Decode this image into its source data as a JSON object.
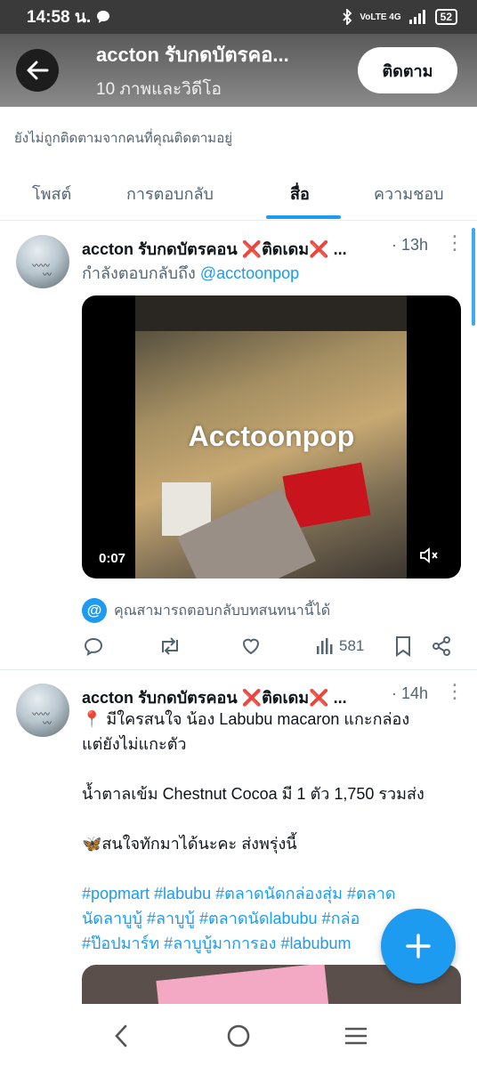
{
  "status_bar": {
    "time": "14:58 น.",
    "network": "VoLTE 4G",
    "battery": "52"
  },
  "header": {
    "title": "accton รับกดบัตรคอ...",
    "subtitle": "10 ภาพและวิดีโอ",
    "follow_label": "ติดตาม"
  },
  "notice": "ยังไม่ถูกติดตามจากคนที่คุณติดตามอยู่",
  "tabs": [
    {
      "label": "โพสต์",
      "active": false
    },
    {
      "label": "การตอบกลับ",
      "active": false
    },
    {
      "label": "สื่อ",
      "active": true
    },
    {
      "label": "ความชอบ",
      "active": false
    }
  ],
  "posts": [
    {
      "author": "accton รับกดบัตรคอน",
      "author_suffix": "ติดเดม",
      "time": "· 13h",
      "reply_prefix": "กำลังตอบกลับถึง",
      "reply_handle": "@acctoonpop",
      "video": {
        "watermark": "Acctoonpop",
        "duration": "0:07"
      },
      "can_reply": "คุณสามารถตอบกลับบทสนทนานี้ได้",
      "views": "581"
    },
    {
      "author": "accton รับกดบัตรคอน",
      "author_suffix": "ติดเดม",
      "time": "· 14h",
      "lines": [
        "📍 มีใครสนใจ น้อง Labubu macaron แกะกล่อง",
        "แต่ยังไม่แกะตัว",
        "น้ำตาลเข้ม Chestnut Cocoa มี 1 ตัว 1,750 รวมส่ง",
        "🦋สนใจทักมาได้นะคะ ส่งพรุ่งนี้"
      ],
      "hashtag_lines": [
        "#popmart #labubu #ตลาดนัดกล่องสุ่ม #ตลาด",
        "นัดลาบูบู้ #ลาบูบู้ #ตลาดนัดlabubu #กล่อ",
        "#ป๊อปมาร์ท #ลาบูบู้มาการอง #labubum"
      ]
    }
  ],
  "colors": {
    "accent": "#1d9bf0",
    "header_bg": "#6b6b6b",
    "text": "#0f1419",
    "muted": "#536471"
  }
}
